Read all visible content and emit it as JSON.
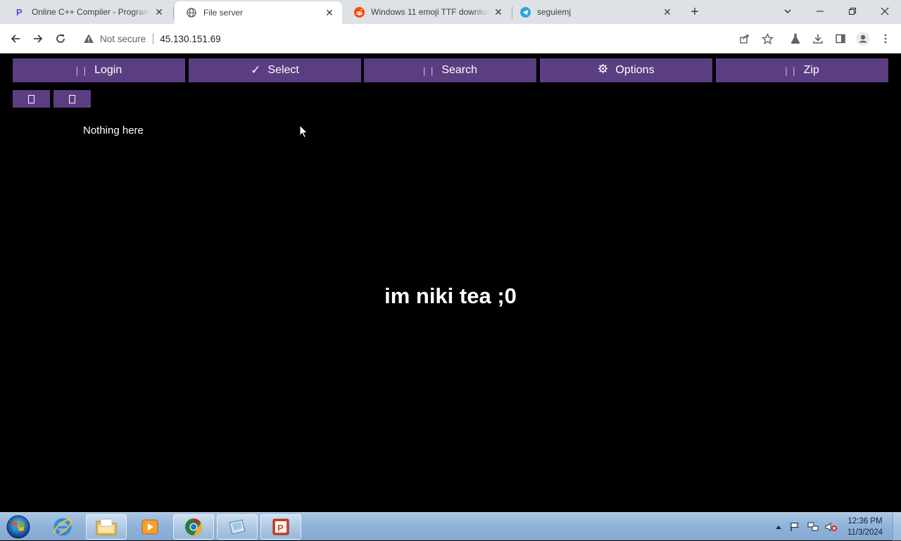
{
  "browser": {
    "tabs": [
      {
        "title": "Online C++ Compiler - Programiz",
        "icon": "programiz-icon",
        "active": false
      },
      {
        "title": "File server",
        "icon": "globe-icon",
        "active": true
      },
      {
        "title": "Windows 11 emoji TTF download",
        "icon": "reddit-icon",
        "active": false
      },
      {
        "title": "seguiemj",
        "icon": "telegram-icon",
        "active": false
      }
    ],
    "new_tab_label": "+",
    "address": {
      "security_label": "Not secure",
      "url": "45.130.151.69"
    }
  },
  "page": {
    "menu": [
      {
        "label": "Login",
        "icon": "login-icon"
      },
      {
        "label": "Select",
        "icon": "checkmark-icon"
      },
      {
        "label": "Search",
        "icon": "search-icon"
      },
      {
        "label": "Options",
        "icon": "gear-icon"
      },
      {
        "label": "Zip",
        "icon": "zip-icon"
      }
    ],
    "small_buttons": [
      {
        "icon": "missing-glyph-icon"
      },
      {
        "icon": "missing-glyph-icon"
      }
    ],
    "empty_message": "Nothing here",
    "motto": "im niki tea ;0"
  },
  "taskbar": {
    "apps": [
      "internet-explorer-icon",
      "file-explorer-icon",
      "media-player-icon",
      "chrome-icon",
      "paint-icon",
      "powerpoint-icon"
    ],
    "clock": {
      "time": "12:36 PM",
      "date": "11/3/2024"
    }
  },
  "colors": {
    "button": "#5b3d82",
    "page_background": "#000000",
    "text": "#ffffff"
  }
}
